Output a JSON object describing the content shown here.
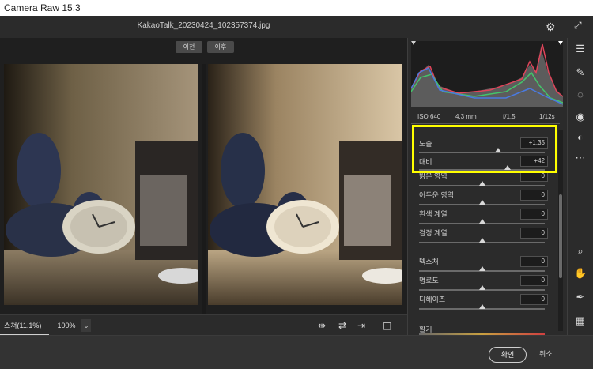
{
  "window": {
    "title": "Camera Raw 15.3"
  },
  "header": {
    "filename": "KakaoTalk_20230424_102357374.jpg"
  },
  "view": {
    "before_label": "이전",
    "after_label": "이후"
  },
  "histogram": {
    "meta": {
      "iso": "ISO 640",
      "focal": "4.3 mm",
      "aperture": "f/1.5",
      "shutter": "1/12s"
    }
  },
  "adjustments": {
    "sliders": [
      {
        "label": "노출",
        "value": "+1.35",
        "position": 0.75
      },
      {
        "label": "대비",
        "value": "+42",
        "position": 0.71
      },
      {
        "label": "밝은 영역",
        "value": "0",
        "position": 0.5
      },
      {
        "label": "어두운 영역",
        "value": "0",
        "position": 0.5
      },
      {
        "label": "흰색 계열",
        "value": "0",
        "position": 0.5
      },
      {
        "label": "검정 계열",
        "value": "0",
        "position": 0.5
      },
      {
        "label": "텍스처",
        "value": "0",
        "position": 0.5
      },
      {
        "label": "명료도",
        "value": "0",
        "position": 0.5
      },
      {
        "label": "디헤이즈",
        "value": "0",
        "position": 0.5
      },
      {
        "label": "활기",
        "value": "",
        "position": 0.5
      }
    ]
  },
  "bottombar": {
    "zoom_fit": "스쳐(11.1%)",
    "zoom_100": "100%"
  },
  "footer": {
    "ok": "확인",
    "cancel": "취소"
  },
  "colors": {
    "highlight": "#ffff00",
    "panel": "#2b2b2b"
  },
  "icons": [
    "gear-icon",
    "fullscreen-icon",
    "edit-sliders-icon",
    "healing-brush-icon",
    "mask-icon",
    "red-eye-icon",
    "presets-icon",
    "more-icon",
    "zoom-icon",
    "hand-icon",
    "sampler-icon",
    "grid-icon"
  ]
}
